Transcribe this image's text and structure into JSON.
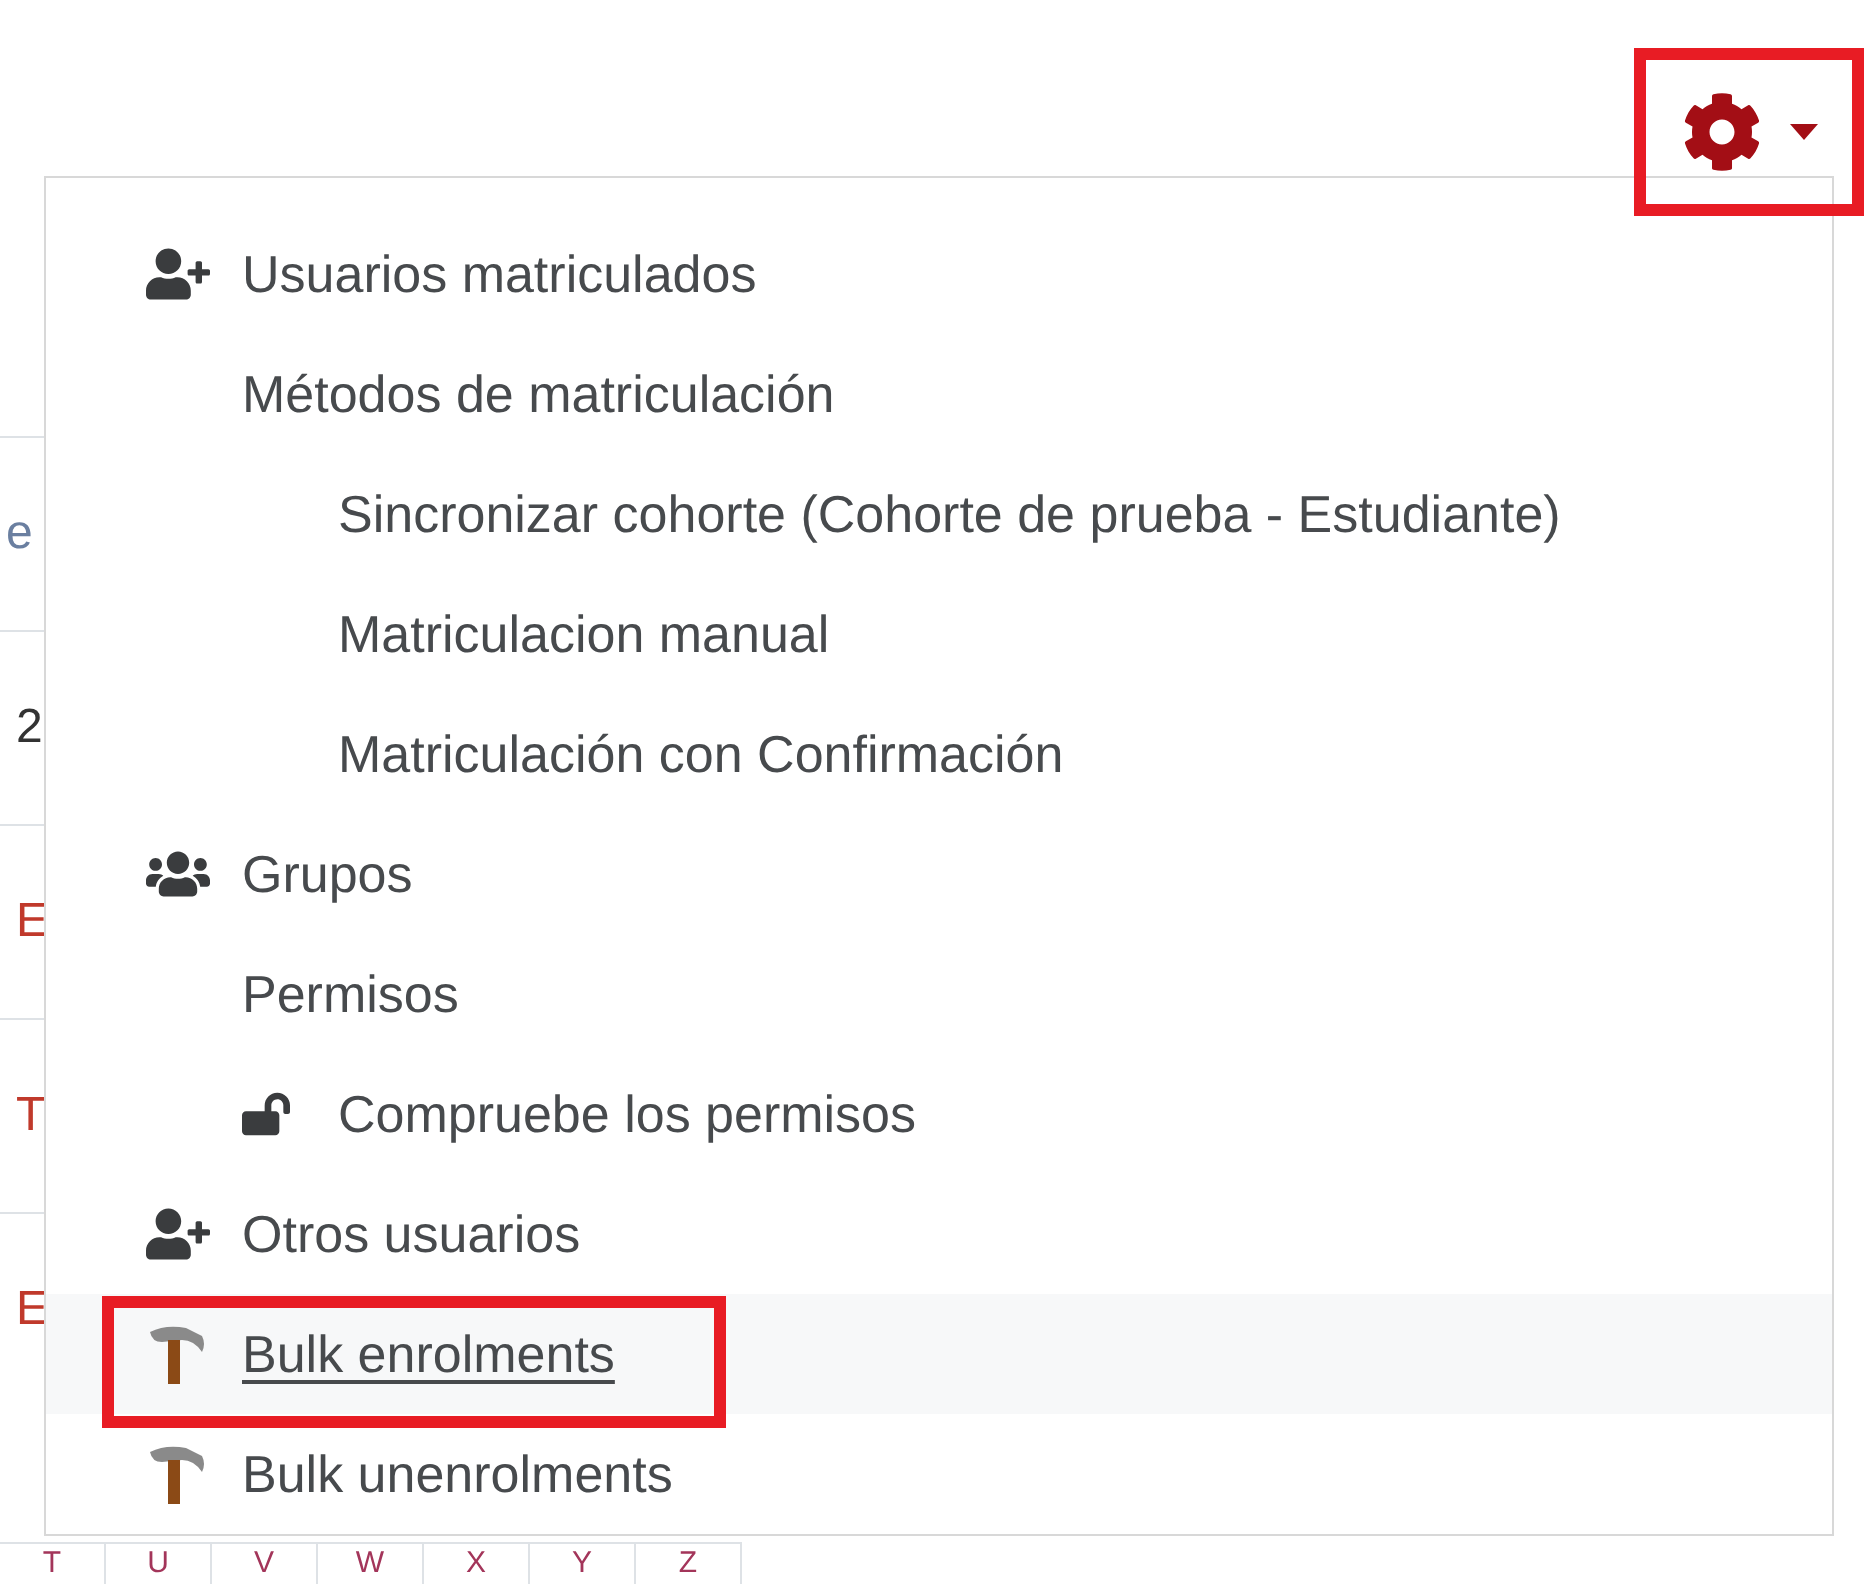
{
  "settings_trigger": {
    "annotated": true
  },
  "background_fragments": [
    {
      "text": "e",
      "kind": "muted"
    },
    {
      "text": "2",
      "kind": "plain"
    },
    {
      "text": "E",
      "kind": "link"
    },
    {
      "text": "T",
      "kind": "link"
    },
    {
      "text": "E",
      "kind": "link"
    }
  ],
  "letter_bar": [
    "T",
    "U",
    "V",
    "W",
    "X",
    "Y",
    "Z"
  ],
  "menu": {
    "items": [
      {
        "label": "Usuarios matriculados",
        "kind": "user-add",
        "selected": false,
        "annotated": false
      },
      {
        "label": "Métodos de matriculación",
        "kind": "plain",
        "selected": false,
        "annotated": false,
        "children": [
          {
            "label": "Sincronizar cohorte (Cohorte de prueba - Estudiante)",
            "kind": "plain",
            "selected": false,
            "annotated": false
          },
          {
            "label": "Matriculacion manual",
            "kind": "plain",
            "selected": false,
            "annotated": false
          },
          {
            "label": "Matriculación con Confirmación",
            "kind": "plain",
            "selected": false,
            "annotated": false
          }
        ]
      },
      {
        "label": "Grupos",
        "kind": "group",
        "selected": false,
        "annotated": false
      },
      {
        "label": "Permisos",
        "kind": "plain",
        "selected": false,
        "annotated": false,
        "children": [
          {
            "label": "Compruebe los permisos",
            "kind": "lock",
            "selected": false,
            "annotated": false
          }
        ]
      },
      {
        "label": "Otros usuarios",
        "kind": "user-add",
        "selected": false,
        "annotated": false
      },
      {
        "label": "Bulk enrolments",
        "kind": "tool",
        "selected": true,
        "annotated": true
      },
      {
        "label": "Bulk unenrolments",
        "kind": "tool",
        "selected": false,
        "annotated": false
      }
    ]
  }
}
